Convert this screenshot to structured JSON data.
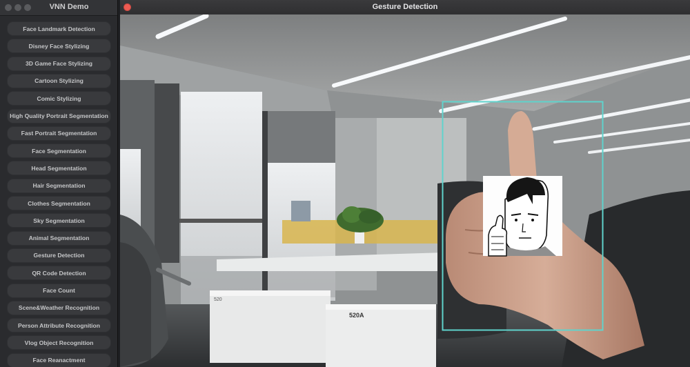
{
  "left_window": {
    "title": "VNN Demo",
    "menu_items": [
      "Face Landmark Detection",
      "Disney Face Stylizing",
      "3D Game Face Stylizing",
      "Cartoon Stylizing",
      "Comic Stylizing",
      "High Quality Portrait Segmentation",
      "Fast Portrait Segmentation",
      "Face Segmentation",
      "Head Segmentation",
      "Hair Segmentation",
      "Clothes Segmentation",
      "Sky Segmentation",
      "Animal Segmentation",
      "Gesture Detection",
      "QR Code Detection",
      "Face Count",
      "Scene&Weather Recognition",
      "Person Attribute Recognition",
      "Vlog Object Recognition",
      "Face Reanactment"
    ]
  },
  "right_window": {
    "title": "Gesture Detection",
    "detection_box_color": "#5fd3cc",
    "sign_labels": [
      "520",
      "520A"
    ]
  }
}
